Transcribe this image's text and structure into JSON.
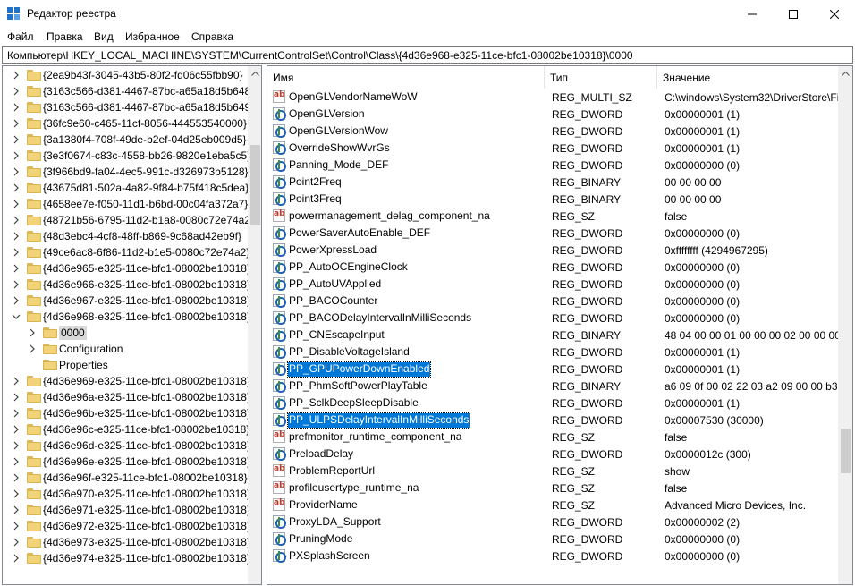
{
  "window": {
    "title": "Редактор реестра",
    "minimize_icon": "minimize-icon",
    "maximize_icon": "maximize-icon",
    "close_icon": "close-icon"
  },
  "menu": [
    "Файл",
    "Правка",
    "Вид",
    "Избранное",
    "Справка"
  ],
  "address": "Компьютер\\HKEY_LOCAL_MACHINE\\SYSTEM\\CurrentControlSet\\Control\\Class\\{4d36e968-e325-11ce-bfc1-08002be10318}\\0000",
  "tree": [
    {
      "label": "{2ea9b43f-3045-43b5-80f2-fd06c55fbb90}",
      "level": 1,
      "arrow": "right"
    },
    {
      "label": "{3163c566-d381-4467-87bc-a65a18d5b648}",
      "level": 1,
      "arrow": "right"
    },
    {
      "label": "{3163c566-d381-4467-87bc-a65a18d5b649}",
      "level": 1,
      "arrow": "right"
    },
    {
      "label": "{36fc9e60-c465-11cf-8056-444553540000}",
      "level": 1,
      "arrow": "right"
    },
    {
      "label": "{3a1380f4-708f-49de-b2ef-04d25eb009d5}",
      "level": 1,
      "arrow": "right"
    },
    {
      "label": "{3e3f0674-c83c-4558-bb26-9820e1eba5c5}",
      "level": 1,
      "arrow": "right"
    },
    {
      "label": "{3f966bd9-fa04-4ec5-991c-d326973b5128}",
      "level": 1,
      "arrow": "right"
    },
    {
      "label": "{43675d81-502a-4a82-9f84-b75f418c5dea}",
      "level": 1,
      "arrow": "right"
    },
    {
      "label": "{4658ee7e-f050-11d1-b6bd-00c04fa372a7}",
      "level": 1,
      "arrow": "right"
    },
    {
      "label": "{48721b56-6795-11d2-b1a8-0080c72e74a2}",
      "level": 1,
      "arrow": "right"
    },
    {
      "label": "{48d3ebc4-4cf8-48ff-b869-9c68ad42eb9f}",
      "level": 1,
      "arrow": "right"
    },
    {
      "label": "{49ce6ac8-6f86-11d2-b1e5-0080c72e74a2}",
      "level": 1,
      "arrow": "right"
    },
    {
      "label": "{4d36e965-e325-11ce-bfc1-08002be10318}",
      "level": 1,
      "arrow": "right"
    },
    {
      "label": "{4d36e966-e325-11ce-bfc1-08002be10318}",
      "level": 1,
      "arrow": "right"
    },
    {
      "label": "{4d36e967-e325-11ce-bfc1-08002be10318}",
      "level": 1,
      "arrow": "right"
    },
    {
      "label": "{4d36e968-e325-11ce-bfc1-08002be10318}",
      "level": 1,
      "arrow": "down"
    },
    {
      "label": "0000",
      "level": 2,
      "arrow": "right",
      "selected": true
    },
    {
      "label": "Configuration",
      "level": 2,
      "arrow": "right"
    },
    {
      "label": "Properties",
      "level": 2,
      "arrow": "none"
    },
    {
      "label": "{4d36e969-e325-11ce-bfc1-08002be10318}",
      "level": 1,
      "arrow": "right"
    },
    {
      "label": "{4d36e96a-e325-11ce-bfc1-08002be10318}",
      "level": 1,
      "arrow": "right"
    },
    {
      "label": "{4d36e96b-e325-11ce-bfc1-08002be10318}",
      "level": 1,
      "arrow": "right"
    },
    {
      "label": "{4d36e96c-e325-11ce-bfc1-08002be10318}",
      "level": 1,
      "arrow": "right"
    },
    {
      "label": "{4d36e96d-e325-11ce-bfc1-08002be10318}",
      "level": 1,
      "arrow": "right"
    },
    {
      "label": "{4d36e96e-e325-11ce-bfc1-08002be10318}",
      "level": 1,
      "arrow": "right"
    },
    {
      "label": "{4d36e96f-e325-11ce-bfc1-08002be10318}",
      "level": 1,
      "arrow": "right"
    },
    {
      "label": "{4d36e970-e325-11ce-bfc1-08002be10318}",
      "level": 1,
      "arrow": "right"
    },
    {
      "label": "{4d36e971-e325-11ce-bfc1-08002be10318}",
      "level": 1,
      "arrow": "right"
    },
    {
      "label": "{4d36e972-e325-11ce-bfc1-08002be10318}",
      "level": 1,
      "arrow": "right"
    },
    {
      "label": "{4d36e973-e325-11ce-bfc1-08002be10318}",
      "level": 1,
      "arrow": "right"
    },
    {
      "label": "{4d36e974-e325-11ce-bfc1-08002be10318}",
      "level": 1,
      "arrow": "right"
    }
  ],
  "columns": {
    "name": "Имя",
    "type": "Тип",
    "data": "Значение"
  },
  "values": [
    {
      "name": "OpenGLVendorNameWoW",
      "type": "REG_MULTI_SZ",
      "data": "C:\\windows\\System32\\DriverStore\\Fi",
      "icon": "sz"
    },
    {
      "name": "OpenGLVersion",
      "type": "REG_DWORD",
      "data": "0x00000001 (1)",
      "icon": "bin"
    },
    {
      "name": "OpenGLVersionWow",
      "type": "REG_DWORD",
      "data": "0x00000001 (1)",
      "icon": "bin"
    },
    {
      "name": "OverrideShowWvrGs",
      "type": "REG_DWORD",
      "data": "0x00000001 (1)",
      "icon": "bin"
    },
    {
      "name": "Panning_Mode_DEF",
      "type": "REG_DWORD",
      "data": "0x00000000 (0)",
      "icon": "bin"
    },
    {
      "name": "Point2Freq",
      "type": "REG_BINARY",
      "data": "00 00 00 00",
      "icon": "bin"
    },
    {
      "name": "Point3Freq",
      "type": "REG_BINARY",
      "data": "00 00 00 00",
      "icon": "bin"
    },
    {
      "name": "powermanagement_delag_component_na",
      "type": "REG_SZ",
      "data": "false",
      "icon": "sz"
    },
    {
      "name": "PowerSaverAutoEnable_DEF",
      "type": "REG_DWORD",
      "data": "0x00000000 (0)",
      "icon": "bin"
    },
    {
      "name": "PowerXpressLoad",
      "type": "REG_DWORD",
      "data": "0xffffffff (4294967295)",
      "icon": "bin"
    },
    {
      "name": "PP_AutoOCEngineClock",
      "type": "REG_DWORD",
      "data": "0x00000000 (0)",
      "icon": "bin"
    },
    {
      "name": "PP_AutoUVApplied",
      "type": "REG_DWORD",
      "data": "0x00000000 (0)",
      "icon": "bin"
    },
    {
      "name": "PP_BACOCounter",
      "type": "REG_DWORD",
      "data": "0x00000000 (0)",
      "icon": "bin"
    },
    {
      "name": "PP_BACODelayIntervalInMilliSeconds",
      "type": "REG_DWORD",
      "data": "0x00000000 (0)",
      "icon": "bin"
    },
    {
      "name": "PP_CNEscapeInput",
      "type": "REG_BINARY",
      "data": "48 04 00 00 01 00 00 00 02 00 00 00 a1",
      "icon": "bin"
    },
    {
      "name": "PP_DisableVoltageIsland",
      "type": "REG_DWORD",
      "data": "0x00000001 (1)",
      "icon": "bin"
    },
    {
      "name": "PP_GPUPowerDownEnabled",
      "type": "REG_DWORD",
      "data": "0x00000001 (1)",
      "icon": "bin",
      "selected": true
    },
    {
      "name": "PP_PhmSoftPowerPlayTable",
      "type": "REG_BINARY",
      "data": "a6 09 0f 00 02 22 03 a2 09 00 00 b3 3f (",
      "icon": "bin"
    },
    {
      "name": "PP_SclkDeepSleepDisable",
      "type": "REG_DWORD",
      "data": "0x00000001 (1)",
      "icon": "bin"
    },
    {
      "name": "PP_ULPSDelayIntervalInMilliSeconds",
      "type": "REG_DWORD",
      "data": "0x00007530 (30000)",
      "icon": "bin",
      "selected": true
    },
    {
      "name": "prefmonitor_runtime_component_na",
      "type": "REG_SZ",
      "data": "false",
      "icon": "sz"
    },
    {
      "name": "PreloadDelay",
      "type": "REG_DWORD",
      "data": "0x0000012c (300)",
      "icon": "bin"
    },
    {
      "name": "ProblemReportUrl",
      "type": "REG_SZ",
      "data": "show",
      "icon": "sz"
    },
    {
      "name": "profileusertype_runtime_na",
      "type": "REG_SZ",
      "data": "false",
      "icon": "sz"
    },
    {
      "name": "ProviderName",
      "type": "REG_SZ",
      "data": "Advanced Micro Devices, Inc.",
      "icon": "sz"
    },
    {
      "name": "ProxyLDA_Support",
      "type": "REG_DWORD",
      "data": "0x00000002 (2)",
      "icon": "bin"
    },
    {
      "name": "PruningMode",
      "type": "REG_DWORD",
      "data": "0x00000000 (0)",
      "icon": "bin"
    },
    {
      "name": "PXSplashScreen",
      "type": "REG_DWORD",
      "data": "0x00000000 (0)",
      "icon": "bin"
    }
  ]
}
